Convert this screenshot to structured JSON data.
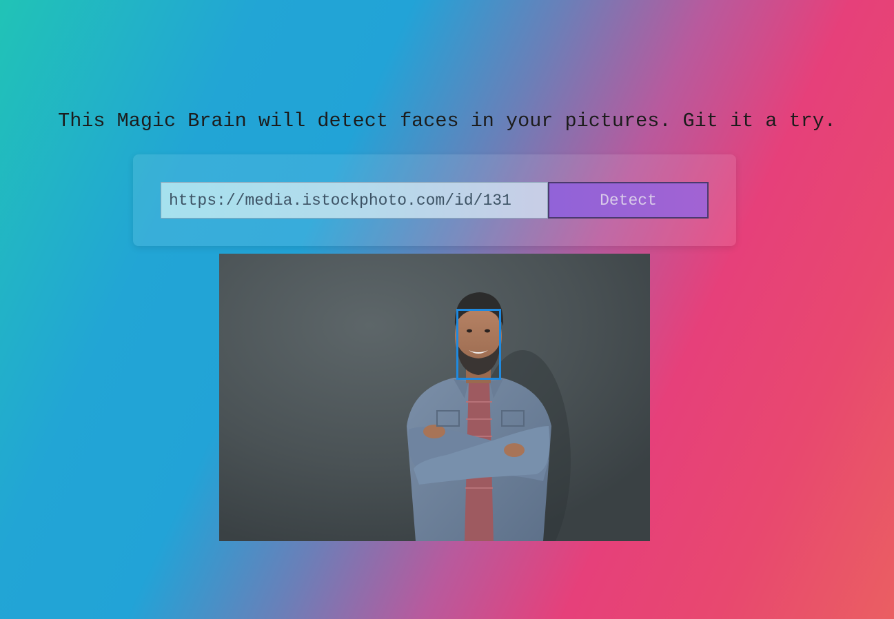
{
  "header": {
    "tagline": "This Magic Brain will detect faces in your pictures. Git it a try."
  },
  "form": {
    "url_value": "https://media.istockphoto.com/id/131",
    "detect_label": "Detect"
  },
  "result": {
    "faces_detected": 1
  },
  "colors": {
    "button": "#9b63d6",
    "face_box": "#1f8ae0",
    "gradient_start": "#21c3b6",
    "gradient_end": "#ea5f62"
  }
}
